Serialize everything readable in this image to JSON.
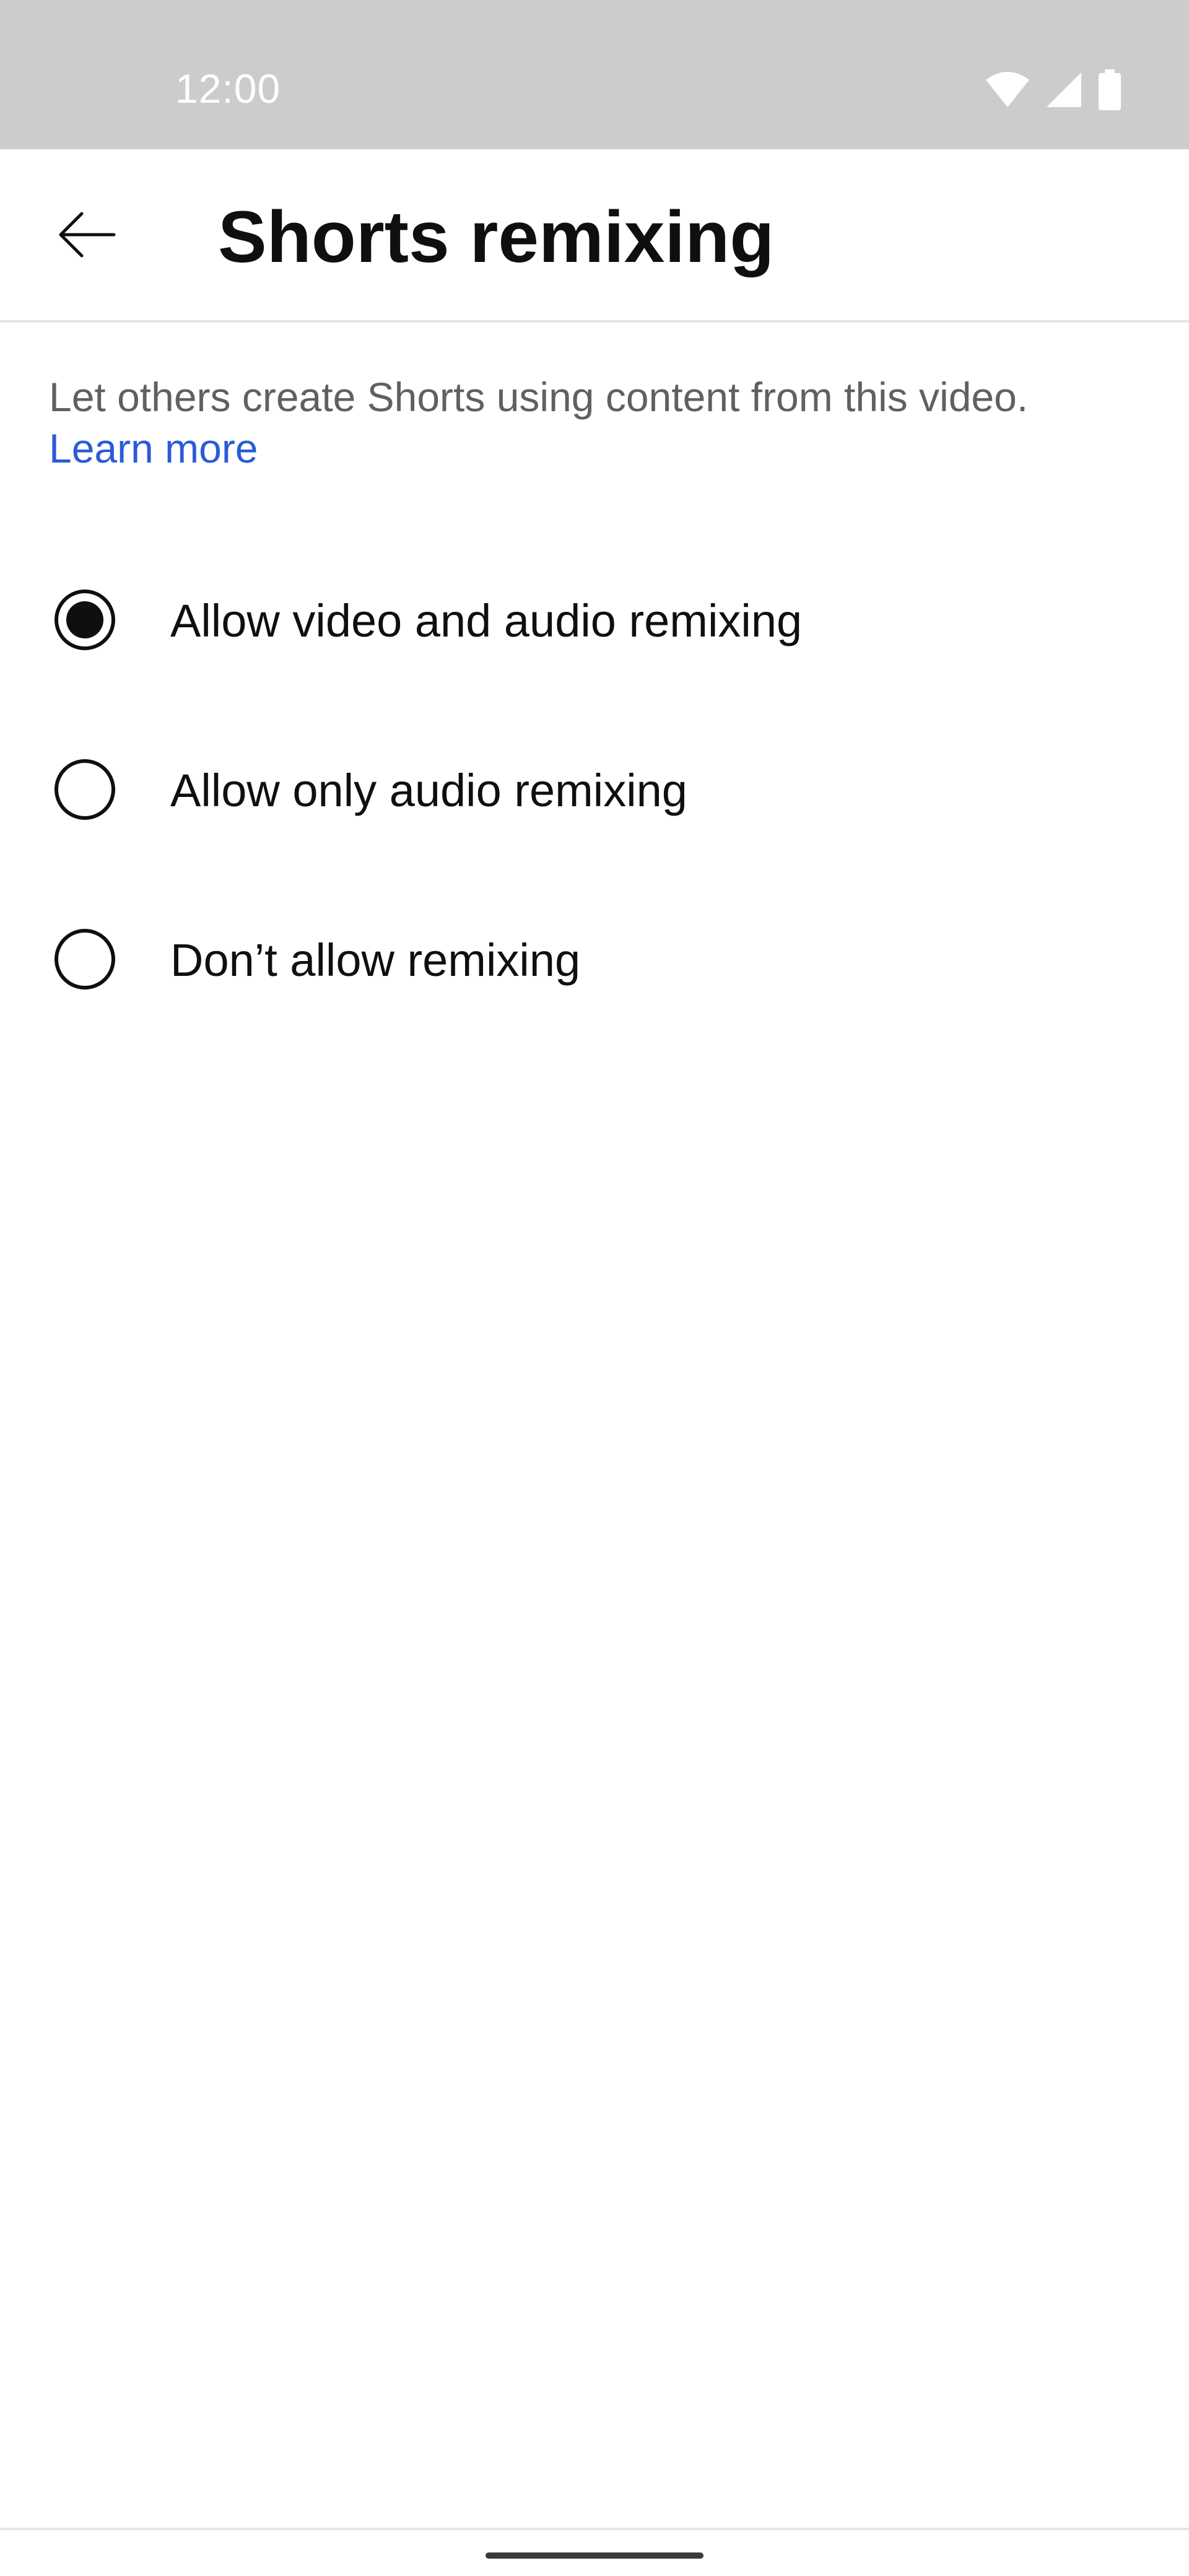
{
  "status_bar": {
    "time": "12:00",
    "icons": [
      "wifi-icon",
      "cellular-signal-icon",
      "battery-icon"
    ]
  },
  "app_bar": {
    "back_icon": "arrow-left-icon",
    "title": "Shorts remixing"
  },
  "description": {
    "text": "Let others create Shorts using content from this video.",
    "link_label": "Learn more"
  },
  "options": [
    {
      "label": "Allow video and audio remixing",
      "selected": true
    },
    {
      "label": "Allow only audio remixing",
      "selected": false
    },
    {
      "label": "Don’t allow remixing",
      "selected": false
    }
  ],
  "colors": {
    "status_bar_bg": "#cccccc",
    "link": "#2a5bd7",
    "text_primary": "#0f0f0f",
    "text_secondary": "#606060"
  }
}
